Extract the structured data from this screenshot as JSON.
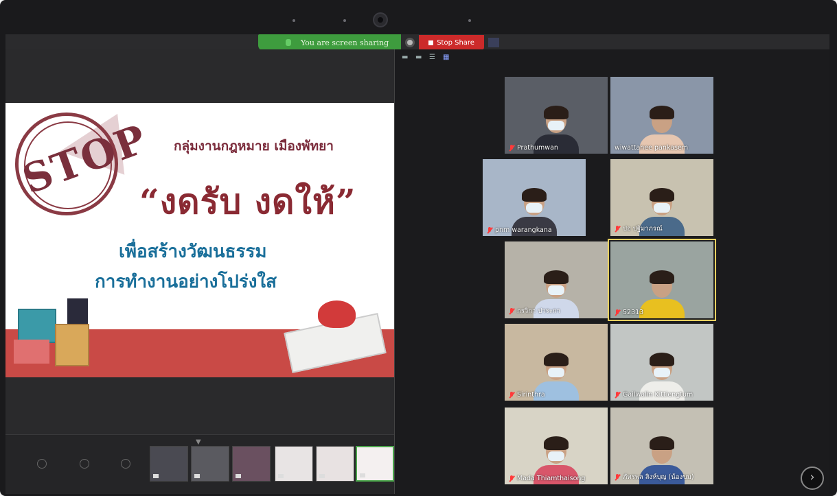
{
  "share_bar": {
    "status": "You are screen sharing",
    "stop_label": "Stop Share"
  },
  "slide": {
    "stamp": "STOP",
    "group": "กลุ่มงานกฎหมาย เมืองพัทยา",
    "headline": "“งดรับ งดให้”",
    "line1": "เพื่อสร้างวัฒนธรรม",
    "line2": "การทำงานอย่างโปร่งใส"
  },
  "participants": [
    {
      "name": "Prathumwan",
      "muted": true,
      "active": false,
      "bg": "#5a5e66",
      "shirt": "#2a2c36",
      "mask": true
    },
    {
      "name": "wiwattanee pankasem",
      "muted": false,
      "active": false,
      "bg": "#8a96a8",
      "shirt": "#e6c6b0",
      "mask": false
    },
    {
      "name": "pnm warangkana",
      "muted": true,
      "active": false,
      "bg": "#a8b6c8",
      "shirt": "#3a3a44",
      "mask": true
    },
    {
      "name": "ปอ ปฐิมาภรณ์",
      "muted": true,
      "active": false,
      "bg": "#c8c2b0",
      "shirt": "#4a6a8a",
      "mask": true
    },
    {
      "name": "กรวิกา ปาระกา",
      "muted": true,
      "active": false,
      "bg": "#b6b2a8",
      "shirt": "#cfd8ea",
      "mask": true
    },
    {
      "name": "52313",
      "muted": true,
      "active": true,
      "bg": "#9aa4a0",
      "shirt": "#e8c020",
      "mask": false
    },
    {
      "name": "Sirinthra",
      "muted": true,
      "active": false,
      "bg": "#c8b8a0",
      "shirt": "#9ec0e0",
      "mask": true
    },
    {
      "name": "Gailwalin Kittiengtum",
      "muted": true,
      "active": false,
      "bg": "#c2c6c4",
      "shirt": "#eeeeea",
      "mask": true
    },
    {
      "name": "Mada Thiamthaisong",
      "muted": true,
      "active": false,
      "bg": "#d8d4c6",
      "shirt": "#d8566a",
      "mask": true
    },
    {
      "name": "ภัทรพล สิงห์บุญ (น้องขม)",
      "muted": true,
      "active": false,
      "bg": "#c4c0b4",
      "shirt": "#3a5a9a",
      "mask": false
    }
  ],
  "colors": {
    "accent_active": "#e8d060",
    "share_green": "#3e9c3e",
    "stop_red": "#cc2a2a",
    "mute_red": "#ff3a3a"
  },
  "icons": [
    "camera-icon",
    "mic-icon",
    "gear-icon",
    "stop-icon",
    "mute-icon",
    "grid-view-icon",
    "chevron-right-icon"
  ]
}
